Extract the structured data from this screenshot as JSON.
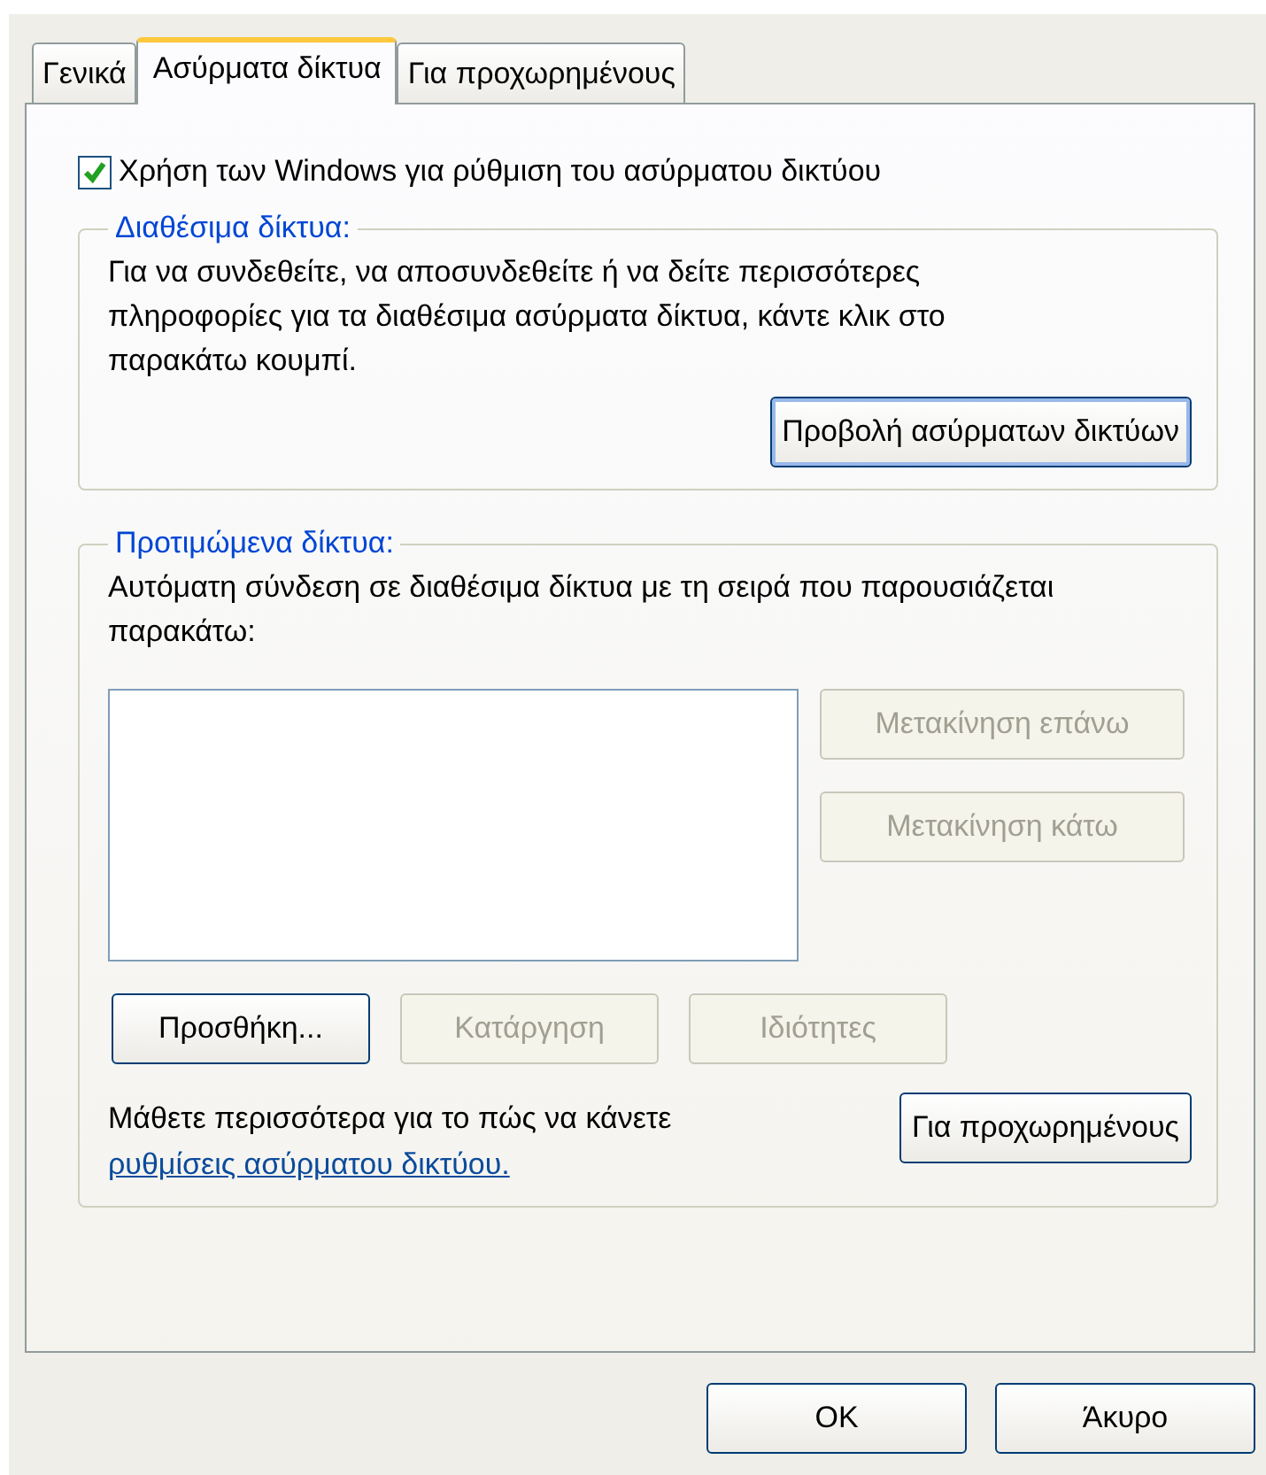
{
  "tabs": [
    {
      "label": "Γενικά",
      "selected": false
    },
    {
      "label": "Ασύρματα δίκτυα",
      "selected": true
    },
    {
      "label": "Για προχωρημένους",
      "selected": false
    }
  ],
  "use_windows_checkbox": {
    "label": "Χρήση των Windows για ρύθμιση του ασύρματου δικτύου",
    "checked": true
  },
  "available_networks": {
    "legend": "Διαθέσιμα δίκτυα:",
    "description": "Για να συνδεθείτε, να αποσυνδεθείτε ή να δείτε περισσότερες πληροφορίες για τα διαθέσιμα ασύρματα δίκτυα, κάντε κλικ στο παρακάτω κουμπί.",
    "button": {
      "label": "Προβολή ασύρματων δικτύων",
      "disabled": false
    }
  },
  "preferred_networks": {
    "legend": "Προτιμώμενα δίκτυα:",
    "description": "Αυτόματη σύνδεση σε διαθέσιμα δίκτυα με τη σειρά που παρουσιάζεται παρακάτω:",
    "side_buttons": [
      {
        "label": "Μετακίνηση επάνω",
        "disabled": true
      },
      {
        "label": "Μετακίνηση κάτω",
        "disabled": true
      }
    ],
    "action_buttons": [
      {
        "label": "Προσθήκη...",
        "disabled": false
      },
      {
        "label": "Κατάργηση",
        "disabled": true
      },
      {
        "label": "Ιδιότητες",
        "disabled": true
      }
    ]
  },
  "learn_more": {
    "text": "Μάθετε περισσότερα για το πώς να κάνετε",
    "link": "ρυθμίσεις ασύρματου δικτύου."
  },
  "advanced_button": {
    "label": "Για προχωρημένους",
    "disabled": false
  },
  "dialog_buttons": [
    {
      "label": "OK",
      "disabled": false
    },
    {
      "label": "Άκυρο",
      "disabled": false
    }
  ]
}
